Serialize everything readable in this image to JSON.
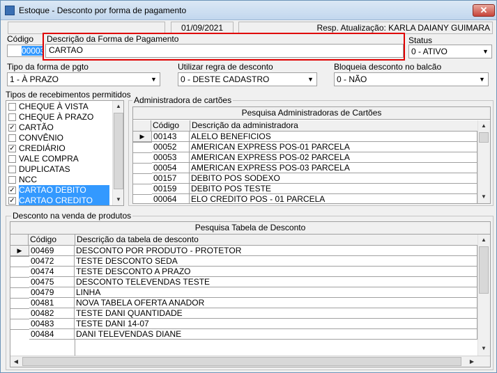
{
  "window": {
    "title": "Estoque - Desconto por forma de pagamento",
    "close": "✕"
  },
  "info": {
    "date": "01/09/2021",
    "resp_label": "Resp. Atualização: KARLA DAIANY GUIMARA"
  },
  "codigo": {
    "label": "Código",
    "value": "00003"
  },
  "descricao": {
    "label": "Descrição da Forma de Pagamento",
    "value": "CARTAO"
  },
  "status": {
    "label": "Status",
    "value": "0 - ATIVO"
  },
  "tipo": {
    "label": "Tipo da forma de pgto",
    "value": "1 - À PRAZO"
  },
  "regra": {
    "label": "Utilizar regra de desconto",
    "value": "0 - DESTE CADASTRO"
  },
  "bloqueia": {
    "label": "Bloqueia desconto no balcão",
    "value": "0 - NÃO"
  },
  "tipos": {
    "label": "Tipos de recebimentos permitidos",
    "items": [
      {
        "label": "CHEQUE À VISTA",
        "checked": false,
        "selected": false
      },
      {
        "label": "CHEQUE À PRAZO",
        "checked": false,
        "selected": false
      },
      {
        "label": "CARTÃO",
        "checked": true,
        "selected": false
      },
      {
        "label": "CONVÊNIO",
        "checked": false,
        "selected": false
      },
      {
        "label": "CREDIÁRIO",
        "checked": true,
        "selected": false
      },
      {
        "label": "VALE COMPRA",
        "checked": false,
        "selected": false
      },
      {
        "label": "DUPLICATAS",
        "checked": false,
        "selected": false
      },
      {
        "label": "NCC",
        "checked": false,
        "selected": false
      },
      {
        "label": "CARTAO DEBITO",
        "checked": true,
        "selected": true
      },
      {
        "label": "CARTAO CREDITO",
        "checked": true,
        "selected": true
      }
    ]
  },
  "admin": {
    "group_label": "Administradora de cartões",
    "caption": "Pesquisa Administradoras de Cartões",
    "col_code": "Código",
    "col_desc": "Descrição da administradora",
    "rows": [
      {
        "code": "00143",
        "desc": "ALELO BENEFICIOS"
      },
      {
        "code": "00052",
        "desc": "AMERICAN EXPRESS POS-01 PARCELA"
      },
      {
        "code": "00053",
        "desc": "AMERICAN EXPRESS POS-02 PARCELA"
      },
      {
        "code": "00054",
        "desc": "AMERICAN EXPRESS POS-03 PARCELA"
      },
      {
        "code": "00157",
        "desc": "DEBITO POS SODEXO"
      },
      {
        "code": "00159",
        "desc": "DEBITO POS TESTE"
      },
      {
        "code": "00064",
        "desc": "ELO CREDITO POS - 01 PARCELA"
      }
    ]
  },
  "desconto": {
    "group_label": "Desconto na venda de produtos",
    "caption": "Pesquisa Tabela de Desconto",
    "col_code": "Código",
    "col_desc": "Descrição da tabela de desconto",
    "rows": [
      {
        "code": "00469",
        "desc": "DESCONTO POR PRODUTO - PROTETOR"
      },
      {
        "code": "00472",
        "desc": "TESTE DESCONTO SEDA"
      },
      {
        "code": "00474",
        "desc": "TESTE DESCONTO A PRAZO"
      },
      {
        "code": "00475",
        "desc": "DESCONTO TELEVENDAS TESTE"
      },
      {
        "code": "00479",
        "desc": "LINHA"
      },
      {
        "code": "00481",
        "desc": "NOVA TABELA OFERTA ANADOR"
      },
      {
        "code": "00482",
        "desc": "TESTE DANI QUANTIDADE"
      },
      {
        "code": "00483",
        "desc": "TESTE DANI 14-07"
      },
      {
        "code": "00484",
        "desc": "DANI TELEVENDAS DIANE"
      }
    ]
  },
  "icons": {
    "indicator": "▶",
    "arrow_up": "▲",
    "arrow_down": "▼",
    "arrow_left": "◀",
    "arrow_right": "▶",
    "check": "✓"
  },
  "colors": {
    "selection": "#3399ff",
    "highlight_border": "#e00000"
  }
}
